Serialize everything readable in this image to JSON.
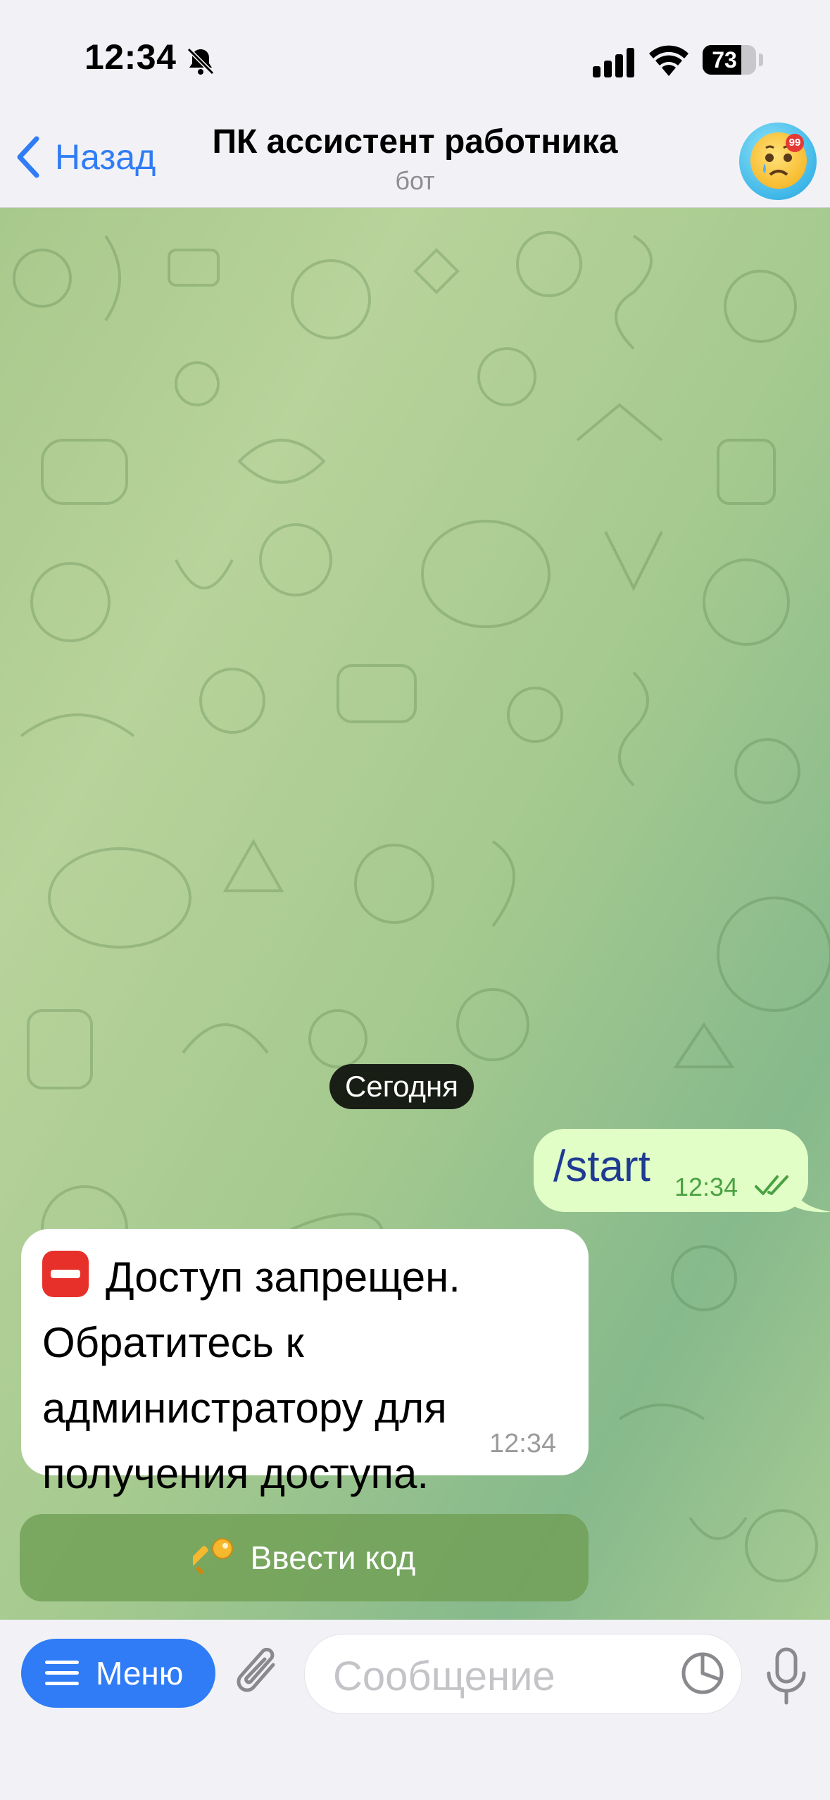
{
  "status_bar": {
    "time": "12:34",
    "battery": "73",
    "battery_level": 0.73
  },
  "header": {
    "back_label": "Назад",
    "title": "ПК ассистент работника",
    "subtitle": "бот",
    "avatar_badge": "99"
  },
  "chat": {
    "date_separator": "Сегодня",
    "messages": [
      {
        "direction": "outgoing",
        "text": "/start",
        "time": "12:34",
        "status": "read"
      },
      {
        "direction": "incoming",
        "text": "Доступ запрещен. Обратитесь к администратору для получения доступа.",
        "time": "12:34"
      }
    ],
    "inline_button": {
      "label": "Ввести код",
      "icon": "key-icon"
    }
  },
  "input_bar": {
    "menu_label": "Меню",
    "placeholder": "Сообщение"
  },
  "colors": {
    "accent": "#2f7cf6",
    "outgoing_bubble": "#e1fec6",
    "incoming_bubble": "#ffffff",
    "read_check": "#4aa143"
  }
}
